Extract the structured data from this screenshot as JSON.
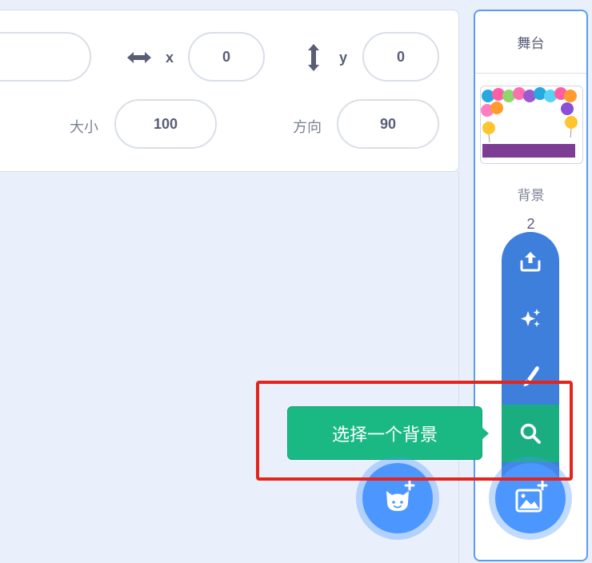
{
  "sprite_info": {
    "x_label": "x",
    "x_value": "0",
    "y_label": "y",
    "y_value": "0",
    "size_label": "大小",
    "size_value": "100",
    "direction_label": "方向",
    "direction_value": "90"
  },
  "stage": {
    "title": "舞台",
    "backdrop_label": "背景",
    "backdrop_count": "2"
  },
  "backdrop_menu": {
    "items": [
      "upload-icon",
      "surprise-icon",
      "paint-icon",
      "search-icon"
    ],
    "tooltip": "选择一个背景"
  },
  "buttons": {
    "sprite_fab_icon": "cat-add-icon",
    "backdrop_fab_icon": "image-add-icon"
  },
  "colors": {
    "accent": "#4c97ff",
    "menu": "#3f7fdc",
    "tooltip": "#1ab983",
    "highlight": "#e5241b"
  }
}
